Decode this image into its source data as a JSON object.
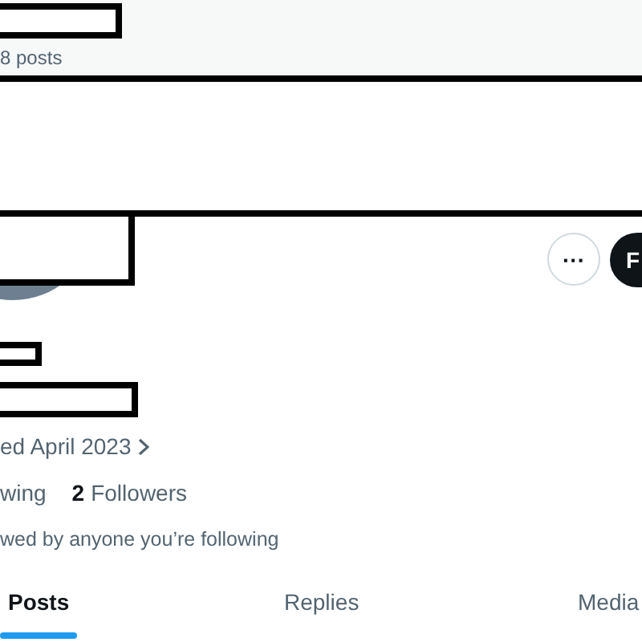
{
  "header": {
    "post_count": "8 posts"
  },
  "profile": {
    "more_button": "···",
    "follow_button": "F",
    "joined": "ed April 2023",
    "following_label": "wing",
    "followers_count": "2",
    "followers_label": "Followers",
    "followed_by": "wed by anyone you’re following"
  },
  "tabs": [
    {
      "label": "Posts",
      "selected": true
    },
    {
      "label": "Replies",
      "selected": false
    },
    {
      "label": "Media",
      "selected": false
    }
  ]
}
